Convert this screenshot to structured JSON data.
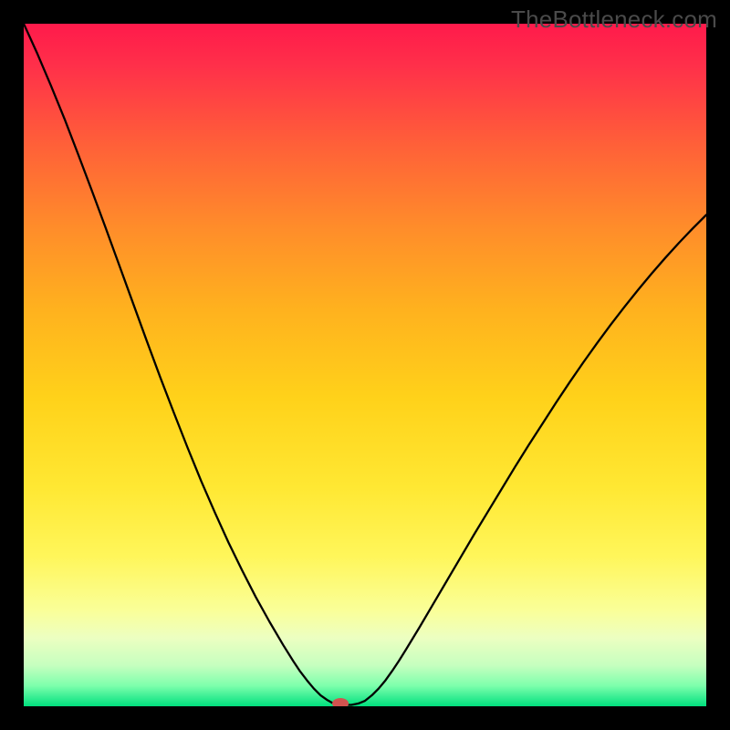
{
  "watermark": {
    "text": "TheBottleneck.com"
  },
  "chart_data": {
    "type": "line",
    "title": "",
    "xlabel": "",
    "ylabel": "",
    "xlim": [
      0,
      100
    ],
    "ylim": [
      0,
      100
    ],
    "background_gradient": {
      "stops": [
        {
          "offset": 0.0,
          "color": "#ff1a4b"
        },
        {
          "offset": 0.06,
          "color": "#ff2f4a"
        },
        {
          "offset": 0.18,
          "color": "#ff6138"
        },
        {
          "offset": 0.3,
          "color": "#ff8d2a"
        },
        {
          "offset": 0.42,
          "color": "#ffb21e"
        },
        {
          "offset": 0.55,
          "color": "#ffd21a"
        },
        {
          "offset": 0.68,
          "color": "#ffe833"
        },
        {
          "offset": 0.78,
          "color": "#fff65a"
        },
        {
          "offset": 0.86,
          "color": "#faff99"
        },
        {
          "offset": 0.9,
          "color": "#ecffc1"
        },
        {
          "offset": 0.94,
          "color": "#c6ffbf"
        },
        {
          "offset": 0.97,
          "color": "#7dffac"
        },
        {
          "offset": 1.0,
          "color": "#00e07e"
        }
      ]
    },
    "series": [
      {
        "name": "curve",
        "color": "#000000",
        "stroke_width": 2.3,
        "x": [
          0,
          2,
          4,
          6,
          8,
          10,
          12,
          14,
          16,
          18,
          20,
          22,
          24,
          26,
          28,
          30,
          32,
          34,
          36,
          38,
          39.5,
          40.5,
          41.5,
          42.5,
          43.5,
          44.5,
          45.2,
          46,
          47,
          48,
          49,
          50,
          51,
          52,
          53,
          54,
          55,
          56,
          58,
          60,
          62,
          64,
          66,
          68,
          70,
          72,
          74,
          76,
          78,
          80,
          82,
          84,
          86,
          88,
          90,
          92,
          94,
          96,
          98,
          100
        ],
        "y": [
          100,
          95.6,
          90.9,
          86.0,
          80.8,
          75.5,
          70.1,
          64.6,
          59.1,
          53.6,
          48.2,
          43.0,
          37.9,
          33.0,
          28.4,
          24.0,
          19.9,
          16.0,
          12.4,
          9.0,
          6.6,
          5.1,
          3.8,
          2.6,
          1.6,
          0.9,
          0.5,
          0.3,
          0.2,
          0.2,
          0.4,
          0.8,
          1.6,
          2.6,
          3.8,
          5.2,
          6.7,
          8.3,
          11.6,
          15.0,
          18.4,
          21.8,
          25.2,
          28.5,
          31.8,
          35.1,
          38.3,
          41.4,
          44.5,
          47.5,
          50.4,
          53.2,
          55.9,
          58.5,
          61.0,
          63.4,
          65.7,
          67.9,
          70.0,
          72.0
        ]
      }
    ],
    "valley": {
      "marker": {
        "x": 46.4,
        "y": 0.0,
        "color": "#d1534f",
        "rx": 9,
        "ry": 6
      }
    }
  }
}
